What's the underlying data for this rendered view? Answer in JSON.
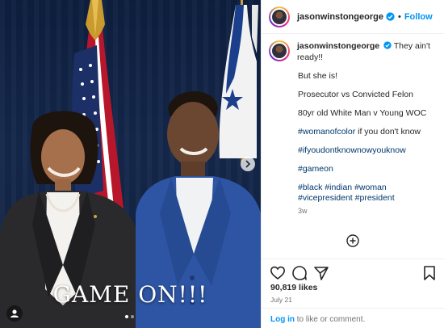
{
  "account": {
    "username": "jasonwinstongeorge",
    "follow_label": "Follow",
    "separator": "•"
  },
  "photo": {
    "caption": "GAME ON!!!",
    "slide_count": 2,
    "current_slide": 1
  },
  "post": {
    "lines": [
      {
        "parts": [
          {
            "text": "They ain't ready!!",
            "tag": false
          }
        ]
      }
    ],
    "paragraphs": [
      [
        {
          "text": "But she is!",
          "tag": false
        }
      ],
      [
        {
          "text": "Prosecutor vs Convicted Felon",
          "tag": false
        }
      ],
      [
        {
          "text": "80yr old White Man v Young WOC",
          "tag": false
        }
      ],
      [
        {
          "text": "#womanofcolor",
          "tag": true
        },
        {
          "text": " if you don't know",
          "tag": false
        }
      ],
      [
        {
          "text": "#ifyoudontknownowyouknow",
          "tag": true
        }
      ],
      [
        {
          "text": "#gameon",
          "tag": true
        }
      ],
      [
        {
          "text": "#black",
          "tag": true
        },
        {
          "text": " ",
          "tag": false
        },
        {
          "text": "#indian",
          "tag": true
        },
        {
          "text": " ",
          "tag": false
        },
        {
          "text": "#woman",
          "tag": true
        },
        {
          "text": " ",
          "tag": false
        },
        {
          "text": "#vicepresident",
          "tag": true
        },
        {
          "text": " ",
          "tag": false
        },
        {
          "text": "#president",
          "tag": true
        }
      ]
    ],
    "first_line": "They ain't ready!!",
    "ago": "3w"
  },
  "stats": {
    "likes": "90,819 likes",
    "date": "July 21"
  },
  "footer": {
    "login_link": "Log in",
    "login_rest": " to like or comment."
  },
  "icons": {
    "like": "heart-icon",
    "comment": "comment-icon",
    "share": "send-icon",
    "save": "bookmark-icon",
    "more": "more-options-icon",
    "verified": "verified-badge-icon",
    "tag": "user-tag-icon",
    "next": "chevron-right-icon",
    "load_more": "plus-circle-icon"
  },
  "colors": {
    "accent": "#0095f6",
    "hashtag": "#00376b",
    "muted": "#737373",
    "verified": "#0095f6"
  }
}
